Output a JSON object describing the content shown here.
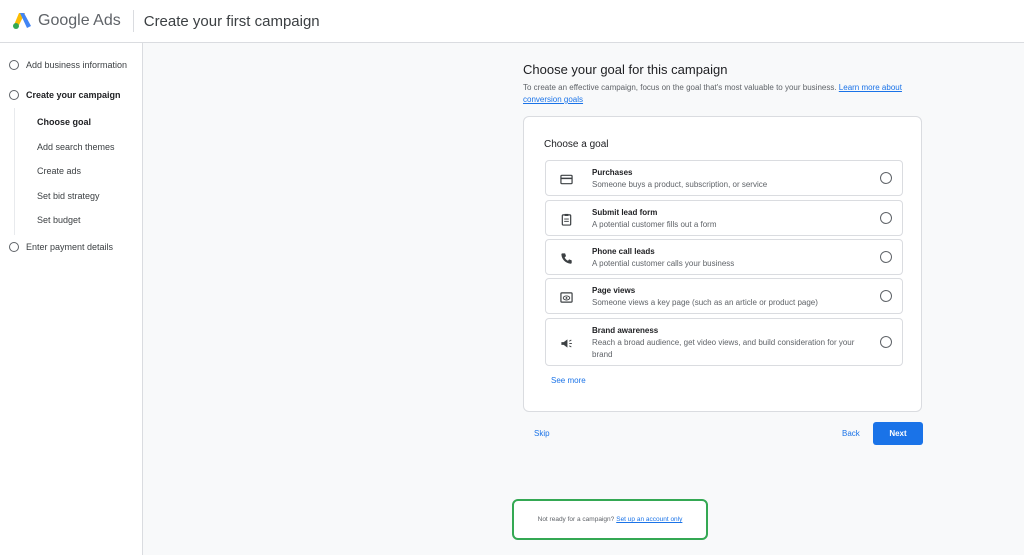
{
  "header": {
    "brand": "Google Ads",
    "title": "Create your first campaign"
  },
  "sidebar": {
    "steps": [
      {
        "label": "Add business information"
      },
      {
        "label": "Create your campaign"
      },
      {
        "label": "Enter payment details"
      }
    ],
    "substeps": [
      {
        "label": "Choose goal"
      },
      {
        "label": "Add search themes"
      },
      {
        "label": "Create ads"
      },
      {
        "label": "Set bid strategy"
      },
      {
        "label": "Set budget"
      }
    ]
  },
  "main": {
    "heading": "Choose your goal for this campaign",
    "subtext": "To create an effective campaign, focus on the goal that's most valuable to your business.",
    "learn_more": "Learn more about conversion goals",
    "card_title": "Choose a goal",
    "options": [
      {
        "title": "Purchases",
        "desc": "Someone buys a product, subscription, or service",
        "icon": "credit-card-icon"
      },
      {
        "title": "Submit lead form",
        "desc": "A potential customer fills out a form",
        "icon": "clipboard-icon"
      },
      {
        "title": "Phone call leads",
        "desc": "A potential customer calls your business",
        "icon": "phone-icon"
      },
      {
        "title": "Page views",
        "desc": "Someone views a key page (such as an article or product page)",
        "icon": "page-view-icon"
      },
      {
        "title": "Brand awareness",
        "desc": "Reach a broad audience, get video views, and build consideration for your brand",
        "icon": "megaphone-icon"
      }
    ],
    "see_more": "See more",
    "skip": "Skip",
    "back": "Back",
    "next": "Next"
  },
  "footer": {
    "not_ready": "Not ready for a campaign?",
    "setup_link": "Set up an account only"
  },
  "colors": {
    "accent": "#1a73e8",
    "highlight_border": "#34a853"
  }
}
